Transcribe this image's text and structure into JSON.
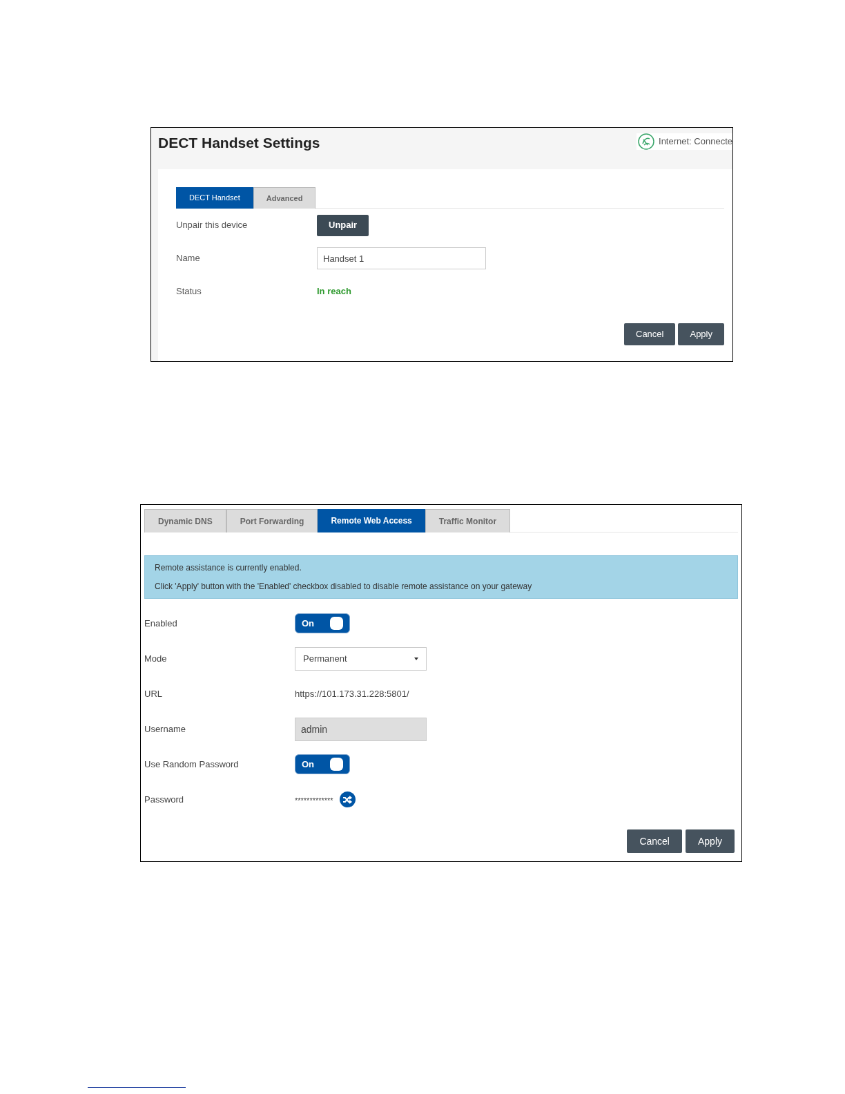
{
  "dect_settings": {
    "title": "DECT Handset Settings",
    "connection_status": "Internet: Connecte",
    "tabs": [
      {
        "label": "DECT Handset",
        "selected": true
      },
      {
        "label": "Advanced",
        "selected": false
      }
    ],
    "rows": [
      {
        "kind": "button",
        "label": "Unpair this device",
        "value": "Unpair"
      },
      {
        "kind": "field",
        "label": "Name",
        "value": "Handset 1"
      },
      {
        "kind": "status",
        "label": "Status",
        "value": "In reach"
      }
    ],
    "buttons": [
      "Cancel",
      "Apply"
    ]
  },
  "remote_access": {
    "tabs": [
      {
        "label": "Dynamic DNS",
        "selected": false
      },
      {
        "label": "Port Forwarding",
        "selected": false
      },
      {
        "label": "Remote Web Access",
        "selected": true
      },
      {
        "label": "Traffic Monitor",
        "selected": false
      }
    ],
    "alert": [
      "Remote assistance is currently enabled.",
      "Click 'Apply' button with the 'Enabled' checkbox disabled to disable remote assistance on your gateway"
    ],
    "rows": [
      {
        "kind": "toggle",
        "label": "Enabled",
        "value": "On",
        "on": true
      },
      {
        "kind": "select",
        "label": "Mode",
        "value": "Permanent"
      },
      {
        "kind": "text",
        "label": "URL",
        "value": "https://101.173.31.228:5801/"
      },
      {
        "kind": "field",
        "label": "Username",
        "value": "admin",
        "disabled": true
      },
      {
        "kind": "toggle",
        "label": "Use Random Password",
        "value": "On",
        "on": true
      },
      {
        "kind": "password",
        "label": "Password",
        "value": "*************"
      }
    ],
    "buttons": [
      "Cancel",
      "Apply"
    ]
  }
}
